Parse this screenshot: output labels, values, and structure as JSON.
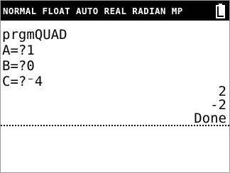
{
  "status_bar": {
    "mode_text": "NORMAL FLOAT AUTO REAL RADIAN MP",
    "battery_icon": "battery-icon",
    "battery_level": 0.85
  },
  "home_screen": {
    "history": [
      "prgmQUAD",
      "A=?1",
      "B=?0",
      "C=?⁻4"
    ],
    "results": [
      "2",
      "-2",
      "Done"
    ]
  },
  "colors": {
    "status_bar_background": "#000000",
    "status_bar_text": "#ffffff",
    "screen_background": "#ffffff",
    "text": "#000000"
  }
}
